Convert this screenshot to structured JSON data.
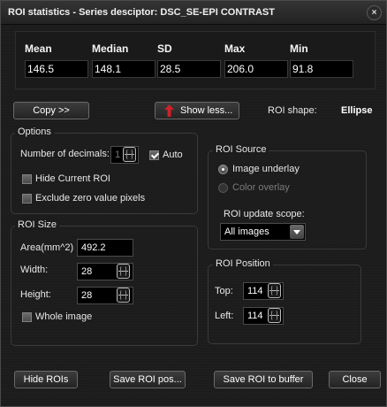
{
  "window": {
    "title": "ROI statistics - Series desciptor: DSC_SE-EPI CONTRAST",
    "close_glyph": "×"
  },
  "stats": [
    {
      "label": "Mean",
      "value": "146.5"
    },
    {
      "label": "Median",
      "value": "148.1"
    },
    {
      "label": "SD",
      "value": "28.5"
    },
    {
      "label": "Max",
      "value": "206.0"
    },
    {
      "label": "Min",
      "value": "91.8"
    }
  ],
  "toolbar": {
    "copy_label": "Copy >>",
    "show_less_label": "Show less...",
    "roi_shape_label": "ROI shape:",
    "roi_shape_value": "Ellipse"
  },
  "options": {
    "title": "Options",
    "decimals_label": "Number of decimals:",
    "decimals_value": "1",
    "auto_label": "Auto",
    "auto_checked": true,
    "hide_current_label": "Hide Current ROI",
    "hide_current_checked": false,
    "exclude_zero_label": "Exclude zero value pixels",
    "exclude_zero_checked": false
  },
  "roi_source": {
    "title": "ROI Source",
    "image_underlay_label": "Image underlay",
    "image_underlay_selected": true,
    "color_overlay_label": "Color overlay",
    "color_overlay_enabled": false,
    "update_scope_label": "ROI update scope:",
    "update_scope_value": "All images"
  },
  "roi_size": {
    "title": "ROI Size",
    "area_label": "Area(mm^2)",
    "area_value": "492.2",
    "width_label": "Width:",
    "width_value": "28",
    "height_label": "Height:",
    "height_value": "28",
    "whole_image_label": "Whole image",
    "whole_image_checked": false
  },
  "roi_position": {
    "title": "ROI Position",
    "top_label": "Top:",
    "top_value": "114",
    "left_label": "Left:",
    "left_value": "114"
  },
  "footer": {
    "hide_rois_label": "Hide ROIs",
    "save_pos_label": "Save ROI pos...",
    "save_buffer_label": "Save ROI to buffer",
    "close_label": "Close"
  },
  "colors": {
    "background": "#1c1c1c",
    "field": "#000000",
    "accent_arrow": "#d0202a"
  }
}
